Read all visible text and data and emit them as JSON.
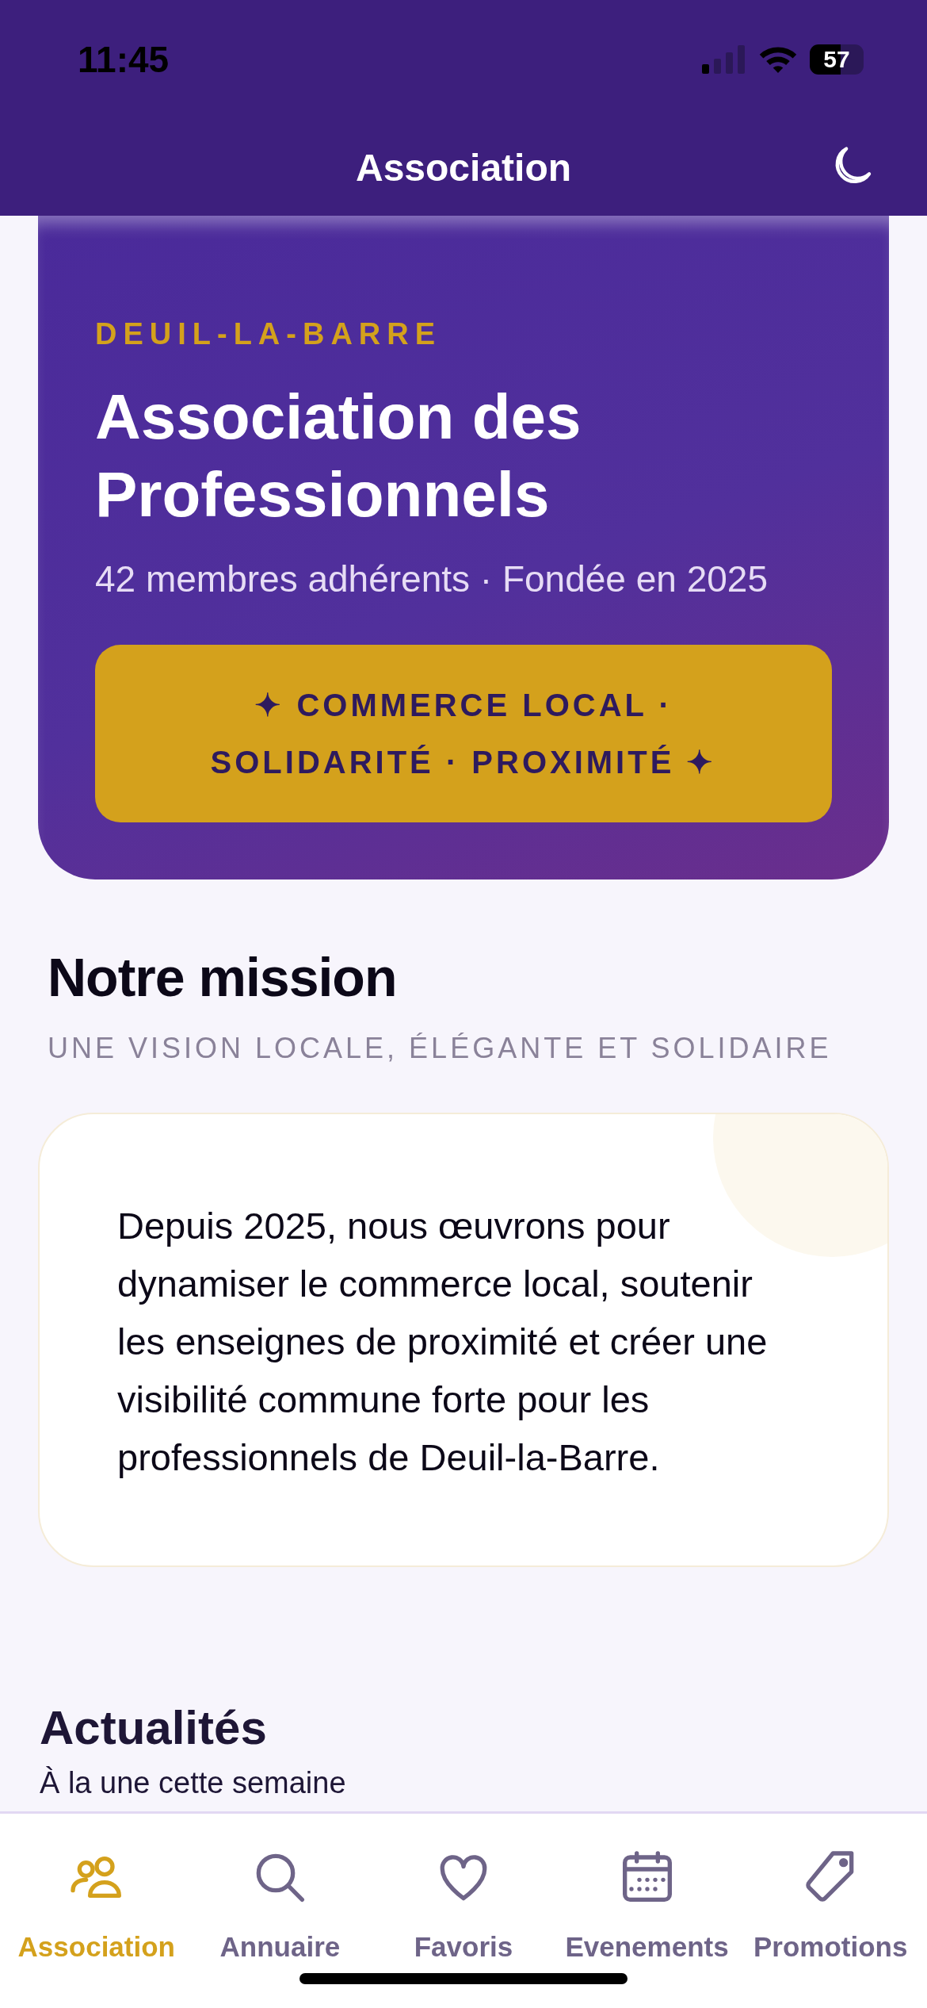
{
  "status_bar": {
    "time": "11:45",
    "battery": "57"
  },
  "header": {
    "title": "Association"
  },
  "hero": {
    "city": "DEUIL-LA-BARRE",
    "title": "Association des Professionnels",
    "subtitle": "42 membres adhérents · Fondée en 2025",
    "motto": "✦ COMMERCE LOCAL · SOLIDARITÉ · PROXIMITÉ ✦"
  },
  "mission": {
    "title": "Notre mission",
    "subtitle": "UNE VISION LOCALE, ÉLÉGANTE ET SOLIDAIRE",
    "text": "Depuis 2025, nous œuvrons pour dynamiser le commerce local, soutenir les enseignes de proximité et créer une visibilité commune forte pour les professionnels de Deuil-la-Barre."
  },
  "news": {
    "title": "Actualités",
    "subtitle": "À la une cette semaine"
  },
  "tabs": [
    {
      "label": "Association",
      "kind": "people",
      "selected": true
    },
    {
      "label": "Annuaire",
      "kind": "search",
      "selected": false
    },
    {
      "label": "Favoris",
      "kind": "heart",
      "selected": false
    },
    {
      "label": "Evenements",
      "kind": "calendar",
      "selected": false
    },
    {
      "label": "Promotions",
      "kind": "tag",
      "selected": false
    }
  ]
}
